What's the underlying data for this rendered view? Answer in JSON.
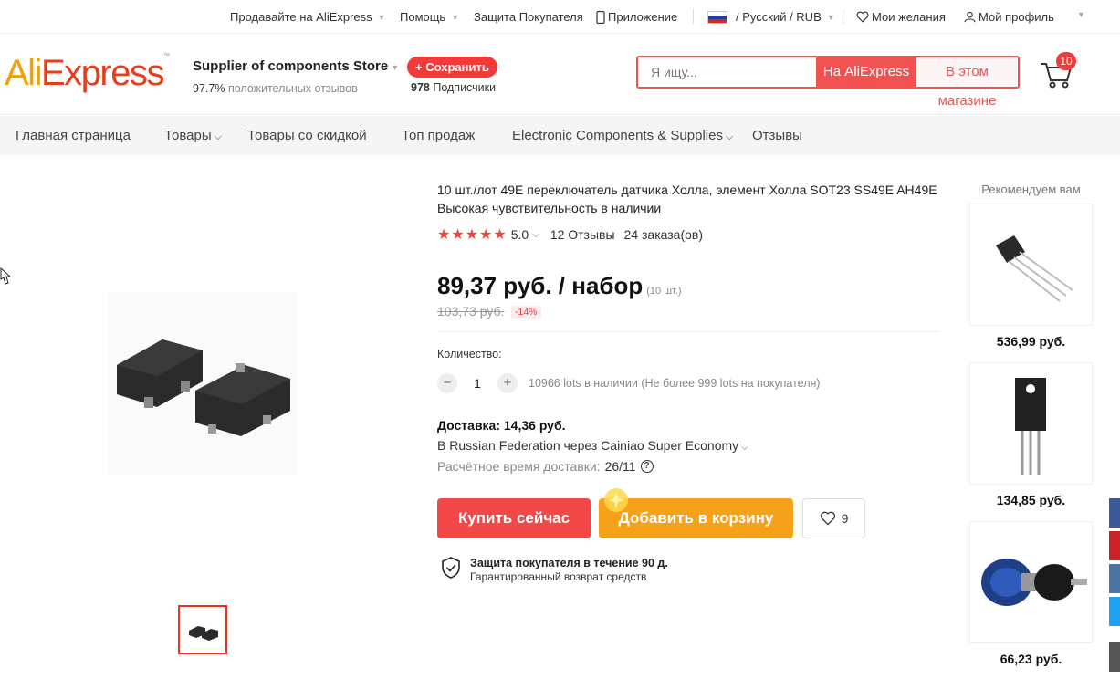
{
  "topbar": {
    "sell": "Продавайте на AliExpress",
    "help": "Помощь",
    "buyer_protection": "Защита Покупателя",
    "app": "Приложение",
    "lang_currency": "/ Русский /  RUB",
    "wishlist": "Мои желания",
    "profile": "Мой профиль"
  },
  "logo": {
    "part1": "Ali",
    "part2": "Express",
    "tm": "™"
  },
  "store": {
    "name": "Supplier of components Store",
    "feedback_pct": "97.7%",
    "feedback_label": "положительных отзывов",
    "save_label": "+ Сохранить",
    "subscribers_count": "978",
    "subscribers_label": "Подписчики"
  },
  "search": {
    "placeholder": "Я ищу...",
    "btn_all": "На AliExpress",
    "btn_store": "В этом магазине"
  },
  "cart": {
    "count": "10"
  },
  "nav": {
    "home": "Главная страница",
    "products": "Товары",
    "discounts": "Товары со скидкой",
    "top": "Топ продаж",
    "category": "Electronic Components & Supplies",
    "reviews": "Отзывы"
  },
  "product": {
    "title": "10 шт./лот 49E переключатель датчика Холла, элемент Холла SOT23 SS49E AH49E Высокая чувствительность в наличии",
    "rating": "5.0",
    "reviews": "12 Отзывы",
    "orders": "24 заказа(ов)",
    "price": "89,37 руб. / набор",
    "price_unit": "(10 шт.)",
    "old_price": "103,73 руб.",
    "discount": "-14%",
    "quantity_label": "Количество:",
    "quantity": "1",
    "stock": "10966 lots в наличии (Не более 999 lots на покупателя)",
    "shipping": "Доставка: 14,36 руб.",
    "shipping_via": "В Russian Federation через Cainiao Super Economy",
    "eta_label": "Расчётное время доставки:",
    "eta_value": "26/11",
    "buy_now": "Купить сейчас",
    "add_to_cart": "Добавить в корзину",
    "wish_count": "9",
    "protection_title": "Защита покупателя в течение 90 д.",
    "protection_sub": "Гарантированный возврат средств"
  },
  "recommend": {
    "title": "Рекомендуем вам",
    "items": [
      {
        "price": "536,99 руб."
      },
      {
        "price": "134,85 руб."
      },
      {
        "price": "66,23 руб."
      }
    ]
  },
  "colors": {
    "accent": "#f23a3a",
    "orange": "#f7a11a",
    "logo_orange": "#f2a100",
    "logo_red": "#e83c1c"
  }
}
